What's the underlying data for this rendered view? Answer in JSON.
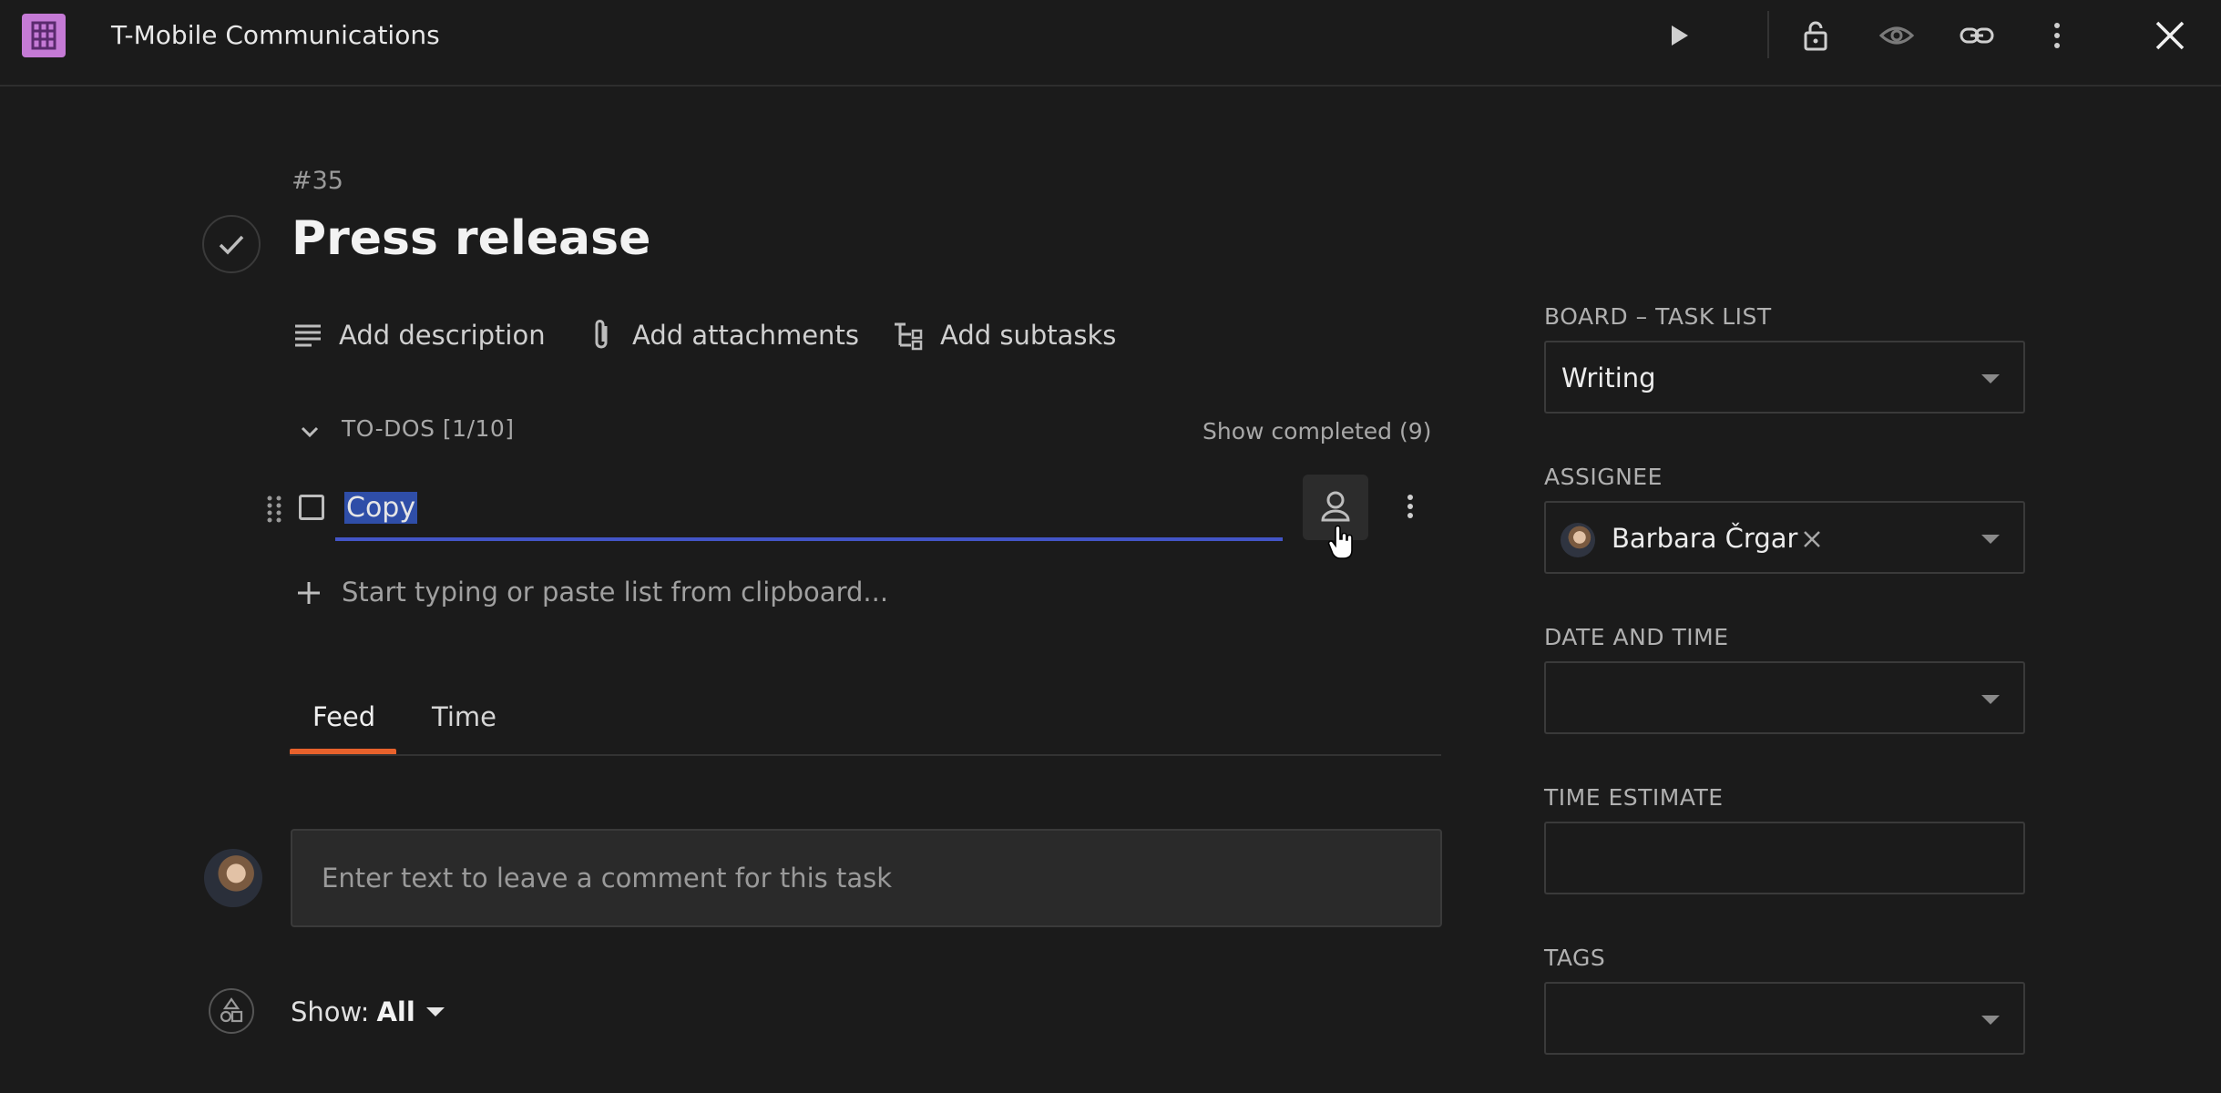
{
  "header": {
    "title": "T-Mobile Communications",
    "icons": [
      "app-grid-icon",
      "play-icon",
      "unlock-icon",
      "eye-icon",
      "link-icon",
      "more-vertical-icon",
      "close-icon"
    ]
  },
  "task": {
    "number": "#35",
    "title": "Press release"
  },
  "actions": {
    "description": "Add description",
    "attachments": "Add attachments",
    "subtasks": "Add subtasks"
  },
  "todos": {
    "header": "TO-DOS [1/10]",
    "show_completed": "Show completed (9)",
    "items": [
      {
        "text": "Copy",
        "checked": false
      }
    ],
    "add_placeholder": "Start typing or paste list from clipboard..."
  },
  "tabs": [
    {
      "label": "Feed",
      "active": true
    },
    {
      "label": "Time",
      "active": false
    }
  ],
  "comment": {
    "placeholder": "Enter text to leave a comment for this task"
  },
  "filter": {
    "prefix": "Show:",
    "value": "All"
  },
  "sidebar": {
    "board_label": "BOARD – TASK LIST",
    "board_value": "Writing",
    "assignee_label": "ASSIGNEE",
    "assignee_name": "Barbara Črgar",
    "date_label": "DATE AND TIME",
    "date_value": "",
    "estimate_label": "TIME ESTIMATE",
    "estimate_value": "",
    "tags_label": "TAGS",
    "tags_value": ""
  },
  "colors": {
    "background": "#1b1b1b",
    "accent_tab": "#e8622c",
    "focus_underline": "#4355c7",
    "selection": "#2f4ea8",
    "app_logo": "#c57ad6"
  }
}
